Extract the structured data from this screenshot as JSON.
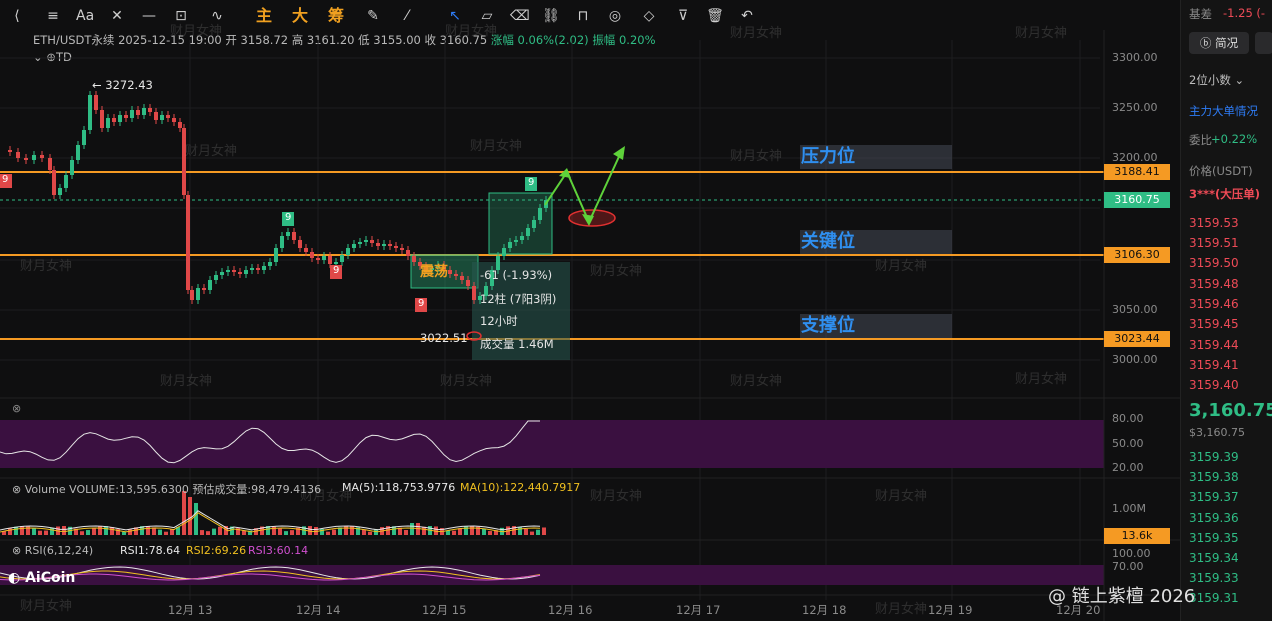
{
  "toolbar": {
    "icons": [
      "collapse-icon",
      "cursor-icon",
      "trendline-icon",
      "lines-icon",
      "text-icon",
      "measure-icon",
      "crosshair-icon",
      "draw-icon"
    ],
    "main_label": "主",
    "big_label": "大",
    "chip_label": "筹"
  },
  "symbol": {
    "name": "ETH/USDT永续",
    "datetime": "2025-12-15 19:00",
    "open_label": "开",
    "open": "3158.72",
    "high_label": "高",
    "high": "3161.20",
    "low_label": "低",
    "low": "3155.00",
    "close_label": "收",
    "close": "3160.75",
    "change_label": "涨幅",
    "change": "0.06%(2.02)",
    "amp_label": "振幅",
    "amp": "0.20%",
    "td_label": "TD"
  },
  "price_axis": [
    "3300.00",
    "3250.00",
    "3200.00",
    "3150.00",
    "3100.00",
    "3050.00",
    "3000.00"
  ],
  "price_labels": {
    "resistance": "3188.41",
    "current": "3160.75",
    "key": "3106.30",
    "support": "3023.44"
  },
  "levels": {
    "resistance": "压力位",
    "key": "关键位",
    "support": "支撑位"
  },
  "annotations": {
    "high": "← 3272.43",
    "low": "3022.51",
    "consolidation": "震荡",
    "td_9": "9"
  },
  "measure": {
    "change": "-61 (-1.93%)",
    "bars": "12柱 (7阳3阴)",
    "duration": "12小时",
    "volume": "成交量 1.46M"
  },
  "rsi_axis": [
    "80.00",
    "50.00",
    "20.00"
  ],
  "volume": {
    "label": "Volume VOLUME:13,595.6300",
    "est": "预估成交量:98,479.4136",
    "ma5": "MA(5):118,753.9776",
    "ma10": "MA(10):122,440.7917",
    "axis": "1.00M",
    "current": "13.6k"
  },
  "rsi2": {
    "label": "RSI(6,12,24)",
    "rsi1": "RSI1:78.64",
    "rsi2": "RSI2:69.26",
    "rsi3": "RSI3:60.14",
    "axis_top": "100.00",
    "axis_mid": "70.00"
  },
  "dates": [
    "12月 13",
    "12月 14",
    "12月 15",
    "12月 16",
    "12月 17",
    "12月 18",
    "12月 19",
    "12月 20"
  ],
  "watermark": "财月女神",
  "logo": "AiCoin",
  "brand": "@ 链上紫檀 2026",
  "right_panel": {
    "basis_label": "基差",
    "basis_value": "-1.25 (-",
    "brief_btn": "简况",
    "decimals": "2位小数",
    "big_orders": "主力大单情况",
    "ratio_label": "委比",
    "ratio_value": "+0.22%",
    "price_header": "价格(USDT)",
    "big_sell": "3***(大压单)",
    "asks": [
      "3159.53",
      "3159.51",
      "3159.50",
      "3159.48",
      "3159.46",
      "3159.45",
      "3159.44",
      "3159.41",
      "3159.40"
    ],
    "last": "3,160.75",
    "last_usd": "$3,160.75",
    "bids": [
      "3159.39",
      "3159.38",
      "3159.37",
      "3159.36",
      "3159.35",
      "3159.34",
      "3159.33",
      "3159.31"
    ]
  }
}
